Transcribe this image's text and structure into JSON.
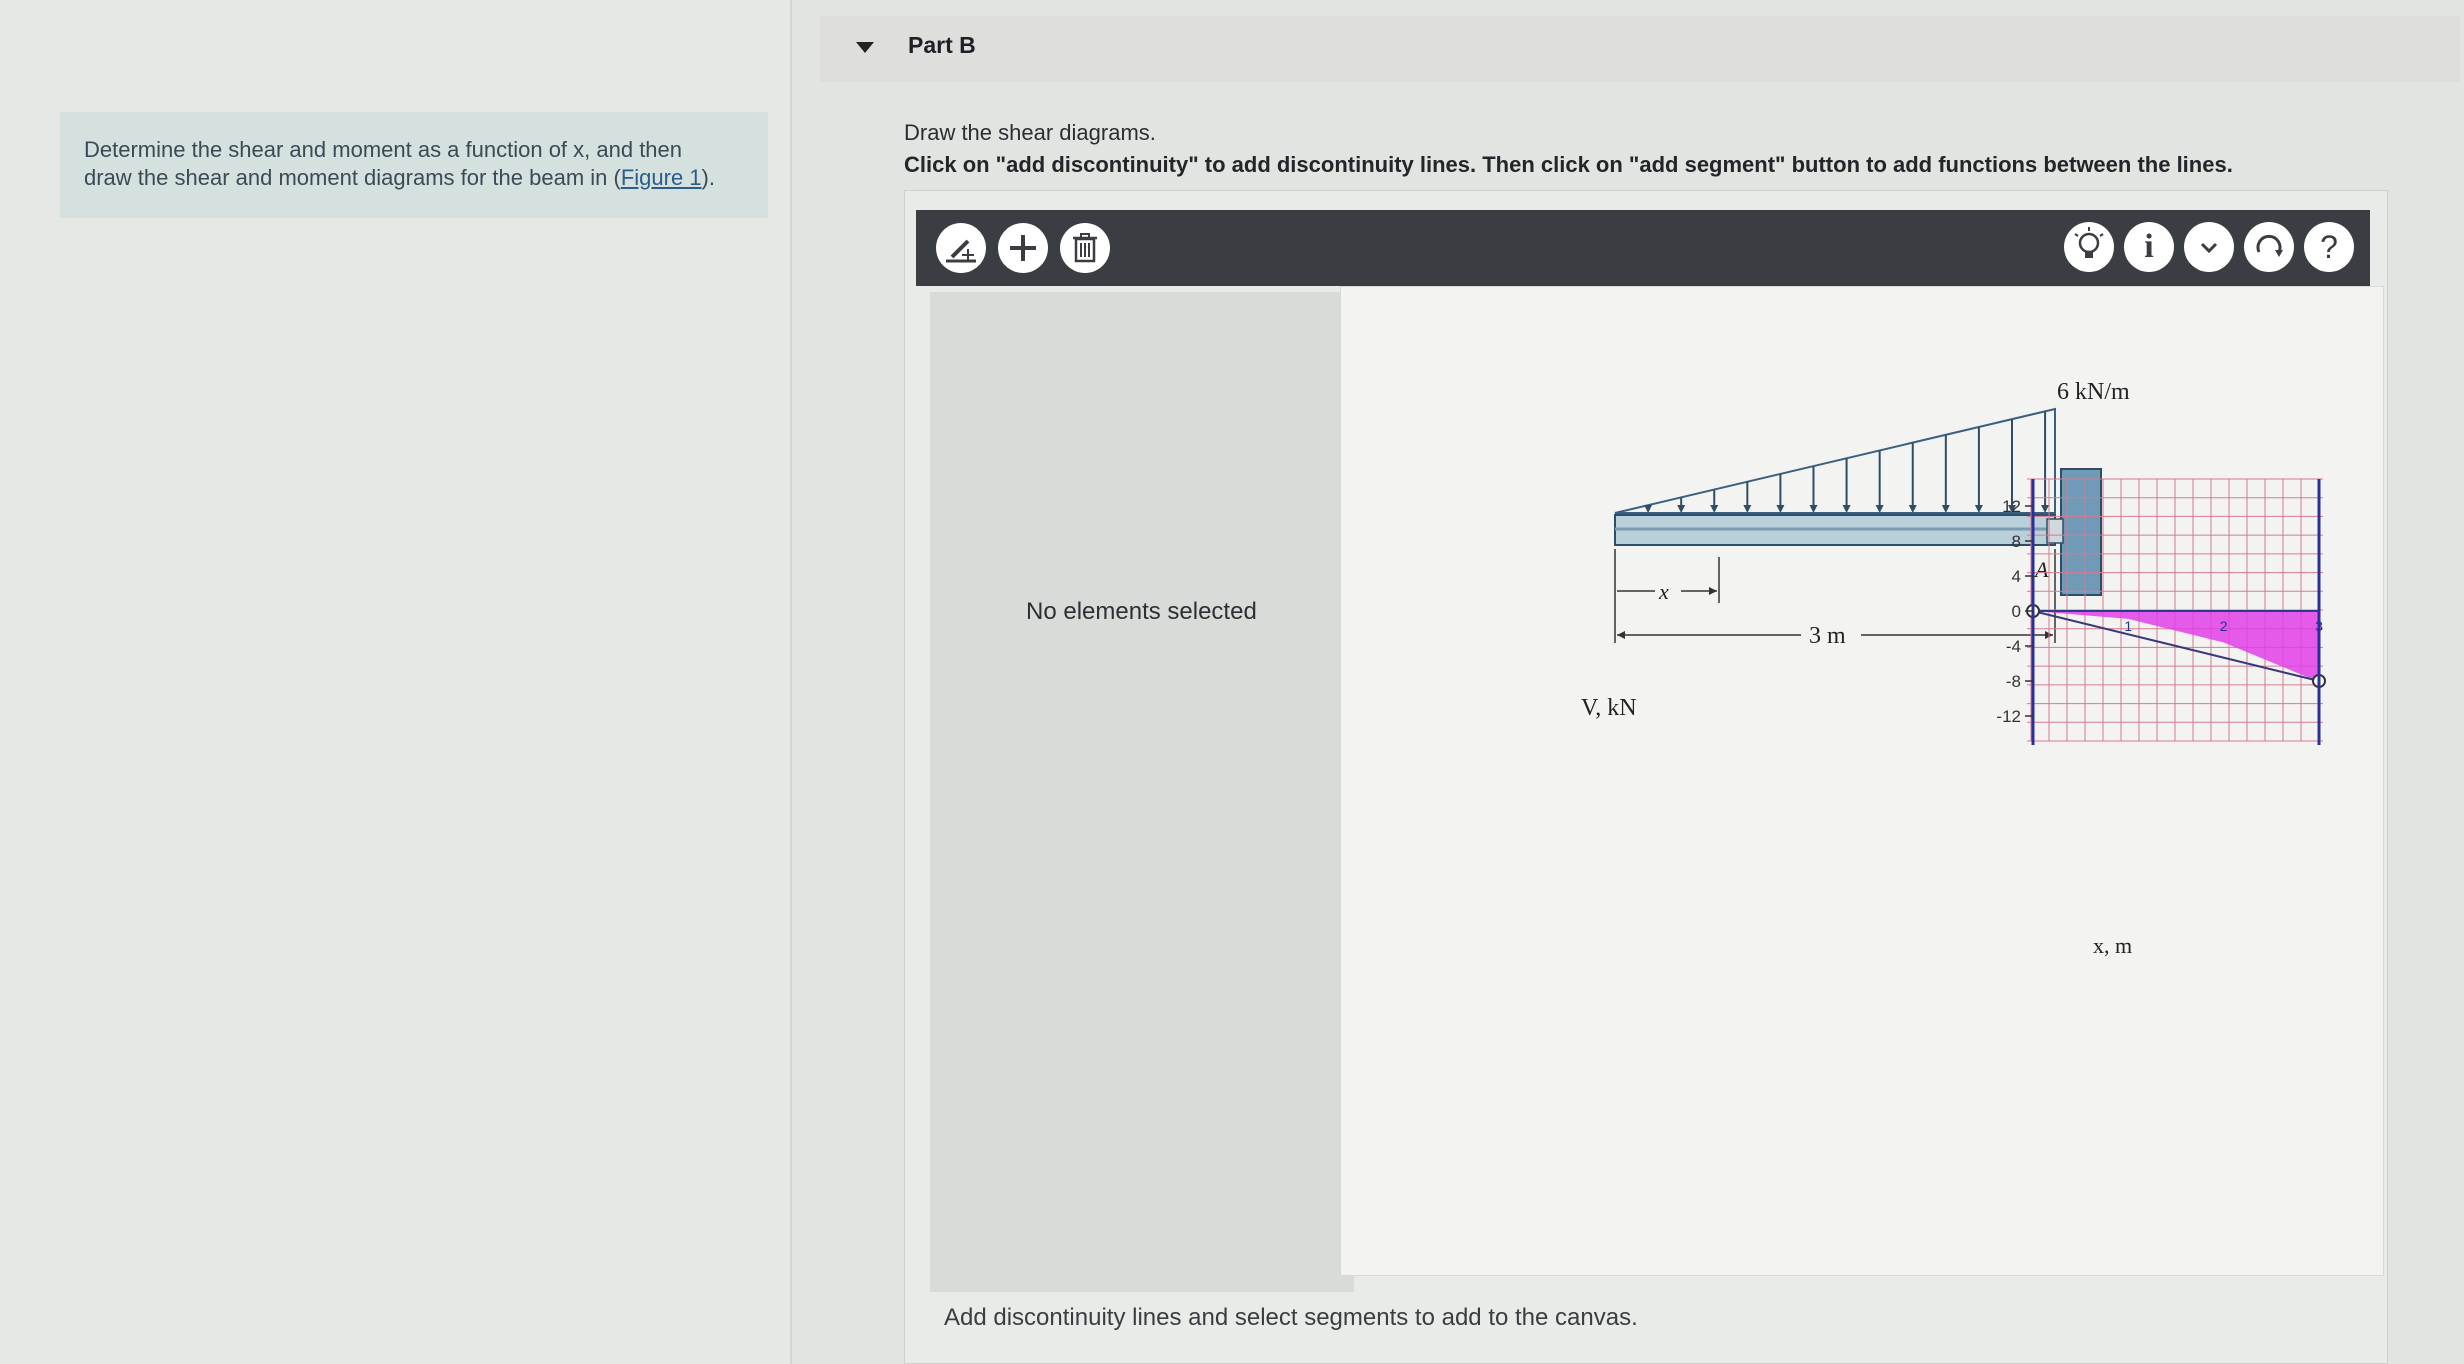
{
  "problem": {
    "line1": "Determine the shear and moment as a function of x, and then",
    "line2_prefix": "draw the shear and moment diagrams for the beam in (",
    "figure_link": "Figure 1",
    "line2_suffix": ")."
  },
  "part": {
    "title": "Part B",
    "instruction": "Draw the shear diagrams.",
    "instruction_bold": "Click on \"add discontinuity\" to add discontinuity lines. Then click on \"add segment\" button to add functions between the lines."
  },
  "toolbar": {
    "left_icons": [
      "add-discontinuity-icon",
      "add-segment-icon",
      "trash-icon"
    ],
    "right_icons": [
      "hint-lightbulb-icon",
      "info-icon",
      "chevron-down-icon",
      "reset-icon",
      "help-icon"
    ],
    "help_label": "?",
    "info_label": "i"
  },
  "sidebar": {
    "status": "No elements selected"
  },
  "figure": {
    "load_label": "6 kN/m",
    "support_label": "A",
    "x_dim_label": "x",
    "length_label": "3 m"
  },
  "chart_data": {
    "type": "area",
    "ylabel": "V, kN",
    "xlabel": "x, m",
    "yticks": [
      12,
      8,
      4,
      0,
      -4,
      -8,
      -12
    ],
    "xticks": [
      1,
      2,
      3
    ],
    "xlim": [
      0,
      3
    ],
    "ylim": [
      -12,
      12
    ],
    "grid": true,
    "series": [
      {
        "x": [
          0,
          1,
          2,
          3
        ],
        "y": [
          0,
          -0.9,
          -3.6,
          -8.1
        ]
      }
    ],
    "fill_color": "#e040e8",
    "endpoints": [
      [
        0,
        0
      ],
      [
        3,
        -8
      ]
    ]
  },
  "footer": {
    "message": "Add discontinuity lines and select segments to add to the canvas."
  }
}
